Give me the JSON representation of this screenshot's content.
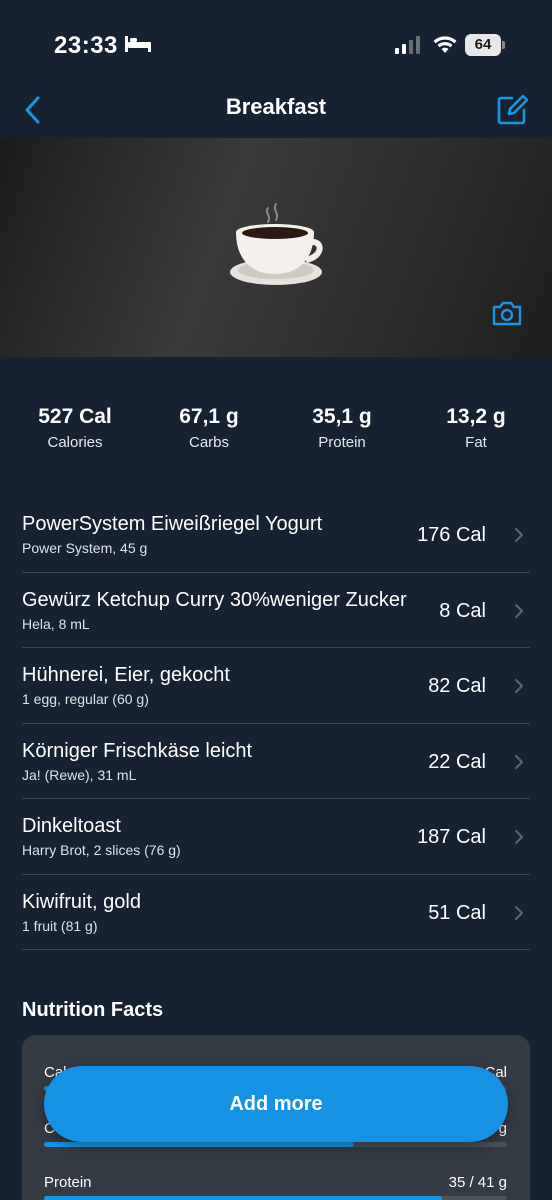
{
  "status_bar": {
    "time": "23:33",
    "battery": "64",
    "icons": [
      "bed-icon",
      "signal-icon",
      "wifi-icon",
      "battery-icon"
    ]
  },
  "nav": {
    "title": "Breakfast",
    "back_icon": "chevron-left-icon",
    "edit_icon": "edit-icon"
  },
  "photo": {
    "emoji": "☕",
    "camera_icon": "camera-icon"
  },
  "summary": [
    {
      "value": "527 Cal",
      "label": "Calories"
    },
    {
      "value": "67,1 g",
      "label": "Carbs"
    },
    {
      "value": "35,1 g",
      "label": "Protein"
    },
    {
      "value": "13,2 g",
      "label": "Fat"
    }
  ],
  "foods": [
    {
      "name": "PowerSystem Eiweißriegel Yogurt",
      "detail": "Power System, 45 g",
      "calories": "176 Cal"
    },
    {
      "name": "Gewürz Ketchup Curry 30%weniger Zucker",
      "detail": "Hela, 8 mL",
      "calories": "8 Cal"
    },
    {
      "name": "Hühnerei, Eier, gekocht",
      "detail": "1 egg, regular (60 g)",
      "calories": "82 Cal"
    },
    {
      "name": "Körniger Frischkäse leicht",
      "detail": "Ja! (Rewe), 31 mL",
      "calories": "22 Cal"
    },
    {
      "name": "Dinkeltoast",
      "detail": "Harry Brot, 2 slices (76 g)",
      "calories": "187 Cal"
    },
    {
      "name": "Kiwifruit, gold",
      "detail": "1 fruit (81 g)",
      "calories": "51 Cal"
    }
  ],
  "nutrition": {
    "title": "Nutrition Facts",
    "rows": [
      {
        "label": "Cal",
        "value": "Cal",
        "fraction": 0.5
      },
      {
        "label": "C",
        "value": "g",
        "fraction": 0.67
      },
      {
        "label": "Protein",
        "value": "35 / 41 g",
        "fraction": 0.86
      }
    ]
  },
  "add_more_label": "Add more",
  "colors": {
    "background": "#162131",
    "accent": "#1592e3",
    "card": "#353b42",
    "divider": "#3a4554"
  }
}
